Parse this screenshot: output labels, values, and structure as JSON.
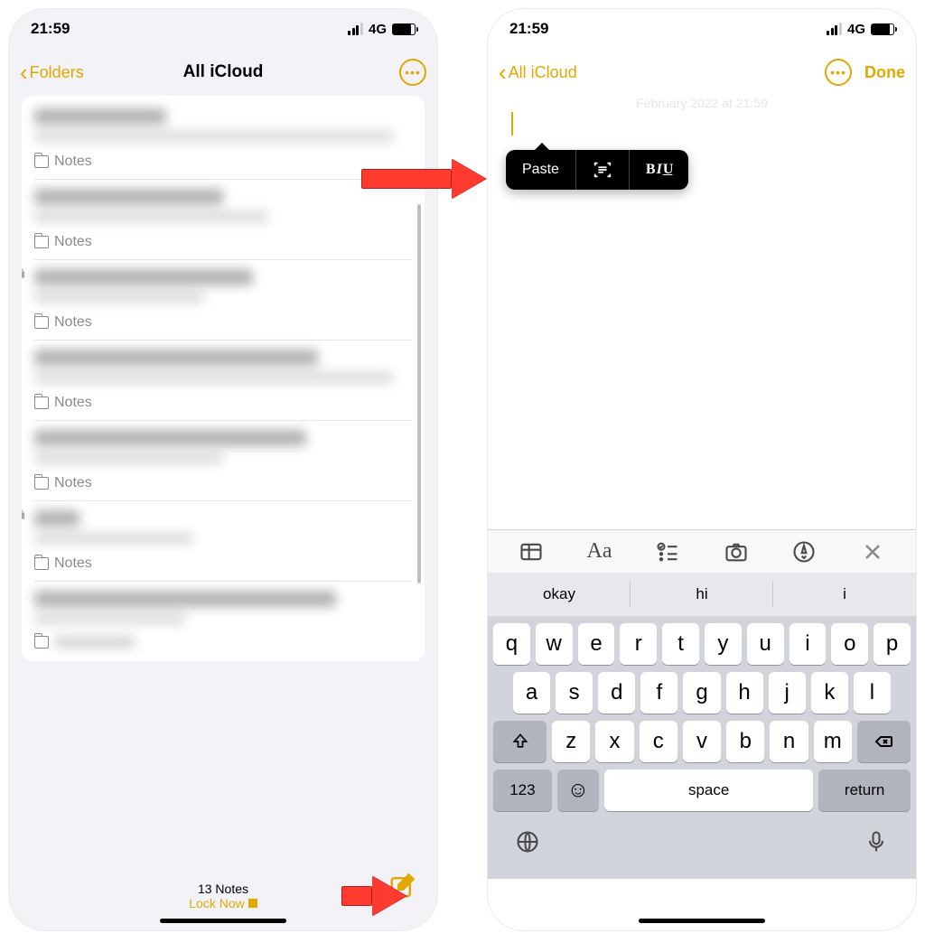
{
  "status": {
    "time": "21:59",
    "network": "4G"
  },
  "left": {
    "back_label": "Folders",
    "title": "All iCloud",
    "folder_label": "Notes",
    "note_count_text": "13 Notes",
    "lock_now_text": "Lock Now",
    "note_rows": 7
  },
  "right": {
    "back_label": "All iCloud",
    "ghost_date": "February 2022 at 21:59",
    "done_label": "Done",
    "context_menu": {
      "paste": "Paste"
    },
    "suggestions": [
      "okay",
      "hi",
      "i"
    ],
    "keys_row1": [
      "q",
      "w",
      "e",
      "r",
      "t",
      "y",
      "u",
      "i",
      "o",
      "p"
    ],
    "keys_row2": [
      "a",
      "s",
      "d",
      "f",
      "g",
      "h",
      "j",
      "k",
      "l"
    ],
    "keys_row3": [
      "z",
      "x",
      "c",
      "v",
      "b",
      "n",
      "m"
    ],
    "key_123": "123",
    "key_space": "space",
    "key_return": "return"
  }
}
